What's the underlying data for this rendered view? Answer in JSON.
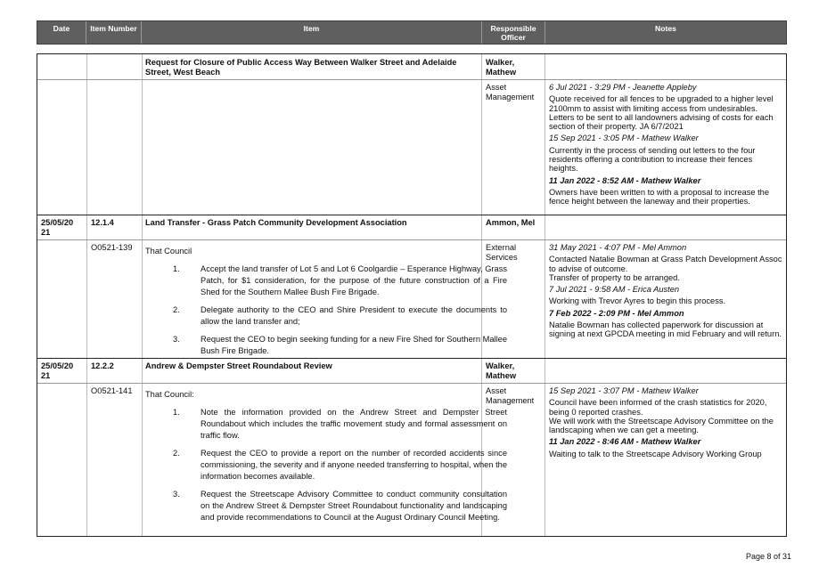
{
  "header": {
    "date": "Date",
    "item_number": "Item Number",
    "item": "Item",
    "responsible_officer": "Responsible Officer",
    "notes": "Notes"
  },
  "rows": [
    {
      "date": "",
      "number": "",
      "title": "Request for Closure of Public Access Way Between Walker Street and Adelaide Street, West Beach",
      "officer": "Walker, Mathew",
      "ref": "",
      "department": "Asset Management",
      "notes": [
        {
          "stamp": "6 Jul 2021 - 3:29 PM - Jeanette Appleby",
          "text": "Quote received for all fences to be upgraded to a higher level 2100mm to assist with limiting access from undesirables.  Letters to be sent to all landowners advising of costs for each section of their property.  JA 6/7/2021"
        },
        {
          "stamp": "15 Sep 2021 - 3:05 PM - Mathew Walker",
          "text": "Currently in the process of sending out letters to the four residents offering a contribution to increase their fences heights."
        },
        {
          "stamp": "11 Jan 2022 - 8:52 AM - Mathew Walker",
          "text": "Owners have been written to with a proposal to increase the fence height between the laneway and their properties."
        }
      ]
    },
    {
      "date": "25/05/20 21",
      "number": "12.1.4",
      "title": "Land Transfer - Grass Patch Community Development Association",
      "officer": "Ammon, Mel",
      "ref": "O0521-139",
      "department": "External Services",
      "resolution_intro": "That Council",
      "resolution": [
        {
          "n": "1.",
          "text": "Accept the land transfer of Lot 5 and Lot 6 Coolgardie – Esperance Highway, Grass Patch, for $1 consideration, for the purpose of the future construction of a Fire Shed for the Southern Mallee Bush Fire Brigade."
        },
        {
          "n": "2.",
          "text": "Delegate authority to the CEO and Shire President to execute the documents to allow the land transfer and;"
        },
        {
          "n": "3.",
          "text": "Request the CEO to begin seeking funding for a new Fire Shed for Southern Mallee Bush Fire Brigade."
        }
      ],
      "notes": [
        {
          "stamp": "31 May 2021 - 4:07 PM - Mel Ammon",
          "text": "Contacted Natalie Bowman at Grass Patch Development Assoc to advise of outcome.\nTransfer of property to be arranged."
        },
        {
          "stamp": "7 Jul 2021 - 9:58 AM - Erica Austen",
          "text": "Working with Trevor Ayres to begin this process."
        },
        {
          "stamp": "7 Feb 2022 - 2:09 PM - Mel Ammon",
          "text": "Natalie Bowman has collected paperwork for discussion at signing at next GPCDA meeting in mid February and will return."
        }
      ]
    },
    {
      "date": "25/05/20 21",
      "number": "12.2.2",
      "title": "Andrew & Dempster Street Roundabout Review",
      "officer": "Walker, Mathew",
      "ref": "O0521-141",
      "department": "Asset Management",
      "resolution_intro": "That Council:",
      "resolution": [
        {
          "n": "1.",
          "text": "Note the information provided on the Andrew Street and Dempster Street Roundabout which includes the traffic movement study and formal assessment on traffic flow."
        },
        {
          "n": "2.",
          "text": "Request the CEO to provide a report on the number of recorded accidents since commissioning, the severity and if anyone needed transferring to hospital, when the information becomes available."
        },
        {
          "n": "3.",
          "text": "Request the Streetscape Advisory Committee to conduct community consultation on the Andrew Street & Dempster Street Roundabout functionality and landscaping and provide recommendations to Council at the August Ordinary Council Meeting."
        }
      ],
      "notes": [
        {
          "stamp": "15 Sep 2021 - 3:07 PM - Mathew Walker",
          "text": "Council have been informed of the crash statistics for 2020, being 0 reported crashes.\nWe will work with the Streetscape Advisory Committee on the landscaping when we can get a meeting."
        },
        {
          "stamp": "11 Jan 2022 - 8:46 AM - Mathew Walker",
          "text": "Waiting to talk to the Streetscape Advisory Working Group"
        }
      ]
    }
  ],
  "footer": {
    "page": "Page 8 of 31"
  }
}
